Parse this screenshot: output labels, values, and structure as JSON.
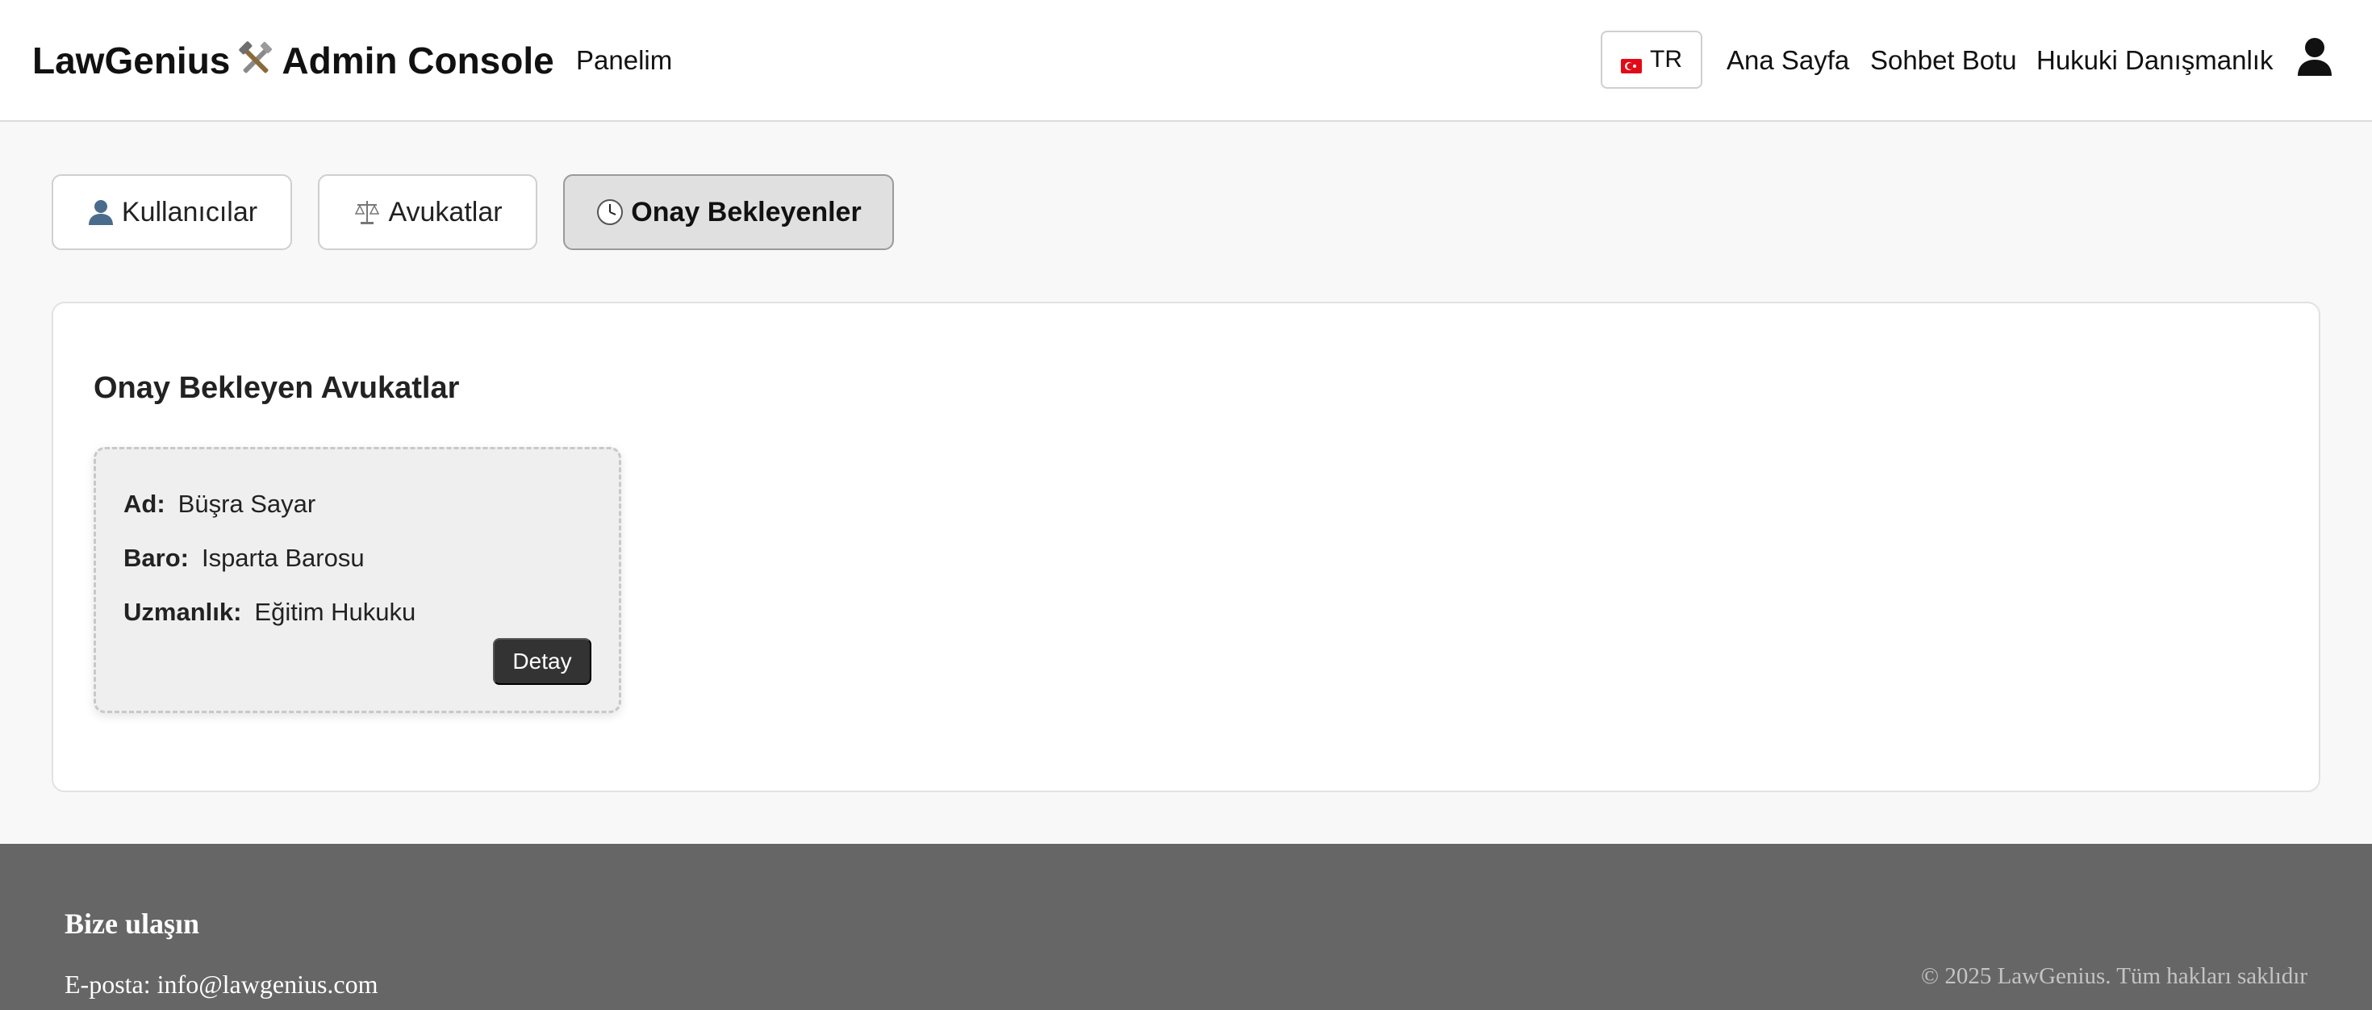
{
  "header": {
    "brand_left": "LawGenius",
    "brand_right": "Admin Console",
    "brand_icon": "tools-icon",
    "panel_link": "Panelim",
    "language": {
      "code": "TR",
      "icon": "turkey-flag-icon"
    },
    "nav": [
      "Ana Sayfa",
      "Sohbet Botu",
      "Hukuki Danışmanlık"
    ],
    "user_icon": "user-icon"
  },
  "tabs": [
    {
      "label": "Kullanıcılar",
      "icon": "user-bust-icon",
      "active": false
    },
    {
      "label": "Avukatlar",
      "icon": "scales-icon",
      "active": false
    },
    {
      "label": "Onay Bekleyenler",
      "icon": "clock-icon",
      "active": true
    }
  ],
  "pending": {
    "title": "Onay Bekleyen Avukatlar",
    "cards": [
      {
        "fields": [
          {
            "label": "Ad:",
            "value": "Büşra Sayar"
          },
          {
            "label": "Baro:",
            "value": "Isparta Barosu"
          },
          {
            "label": "Uzmanlık:",
            "value": "Eğitim Hukuku"
          }
        ],
        "action": "Detay"
      }
    ]
  },
  "footer": {
    "title": "Bize ulaşın",
    "email": "E-posta: info@lawgenius.com",
    "copyright": "© 2025 LawGenius. Tüm hakları saklıdır"
  },
  "colors": {
    "header_bg": "#ffffff",
    "page_bg": "#f8f8f8",
    "active_tab_bg": "#e0e0e0",
    "card_bg": "#efefef",
    "button_bg": "#333333",
    "footer_bg": "#666666"
  }
}
